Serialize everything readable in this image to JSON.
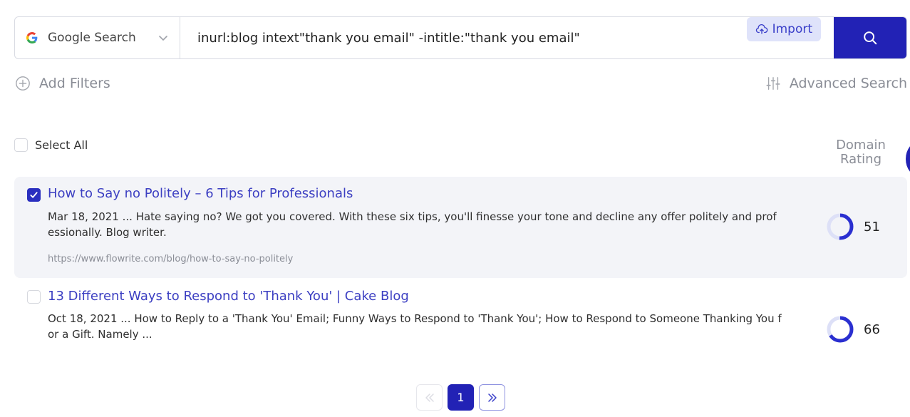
{
  "search": {
    "engine_label": "Google Search",
    "query": "inurl:blog intext\"thank you email\" -intitle:\"thank you email\"",
    "import_label": "Import"
  },
  "filters": {
    "add_label": "Add Filters",
    "advanced_label": "Advanced Search"
  },
  "list": {
    "select_all_label": "Select All",
    "dr_header_line1": "Domain",
    "dr_header_line2": "Rating"
  },
  "results": [
    {
      "title": "How to Say no Politely – 6 Tips for Professionals",
      "snippet": "Mar 18, 2021 ... Hate saying no? We got you covered. With these six tips, you'll finesse your tone and decline any offer politely and professionally. Blog writer.",
      "url": "https://www.flowrite.com/blog/how-to-say-no-politely",
      "domain_rating": 51,
      "checked": true
    },
    {
      "title": "13 Different Ways to Respond to 'Thank You' | Cake Blog",
      "snippet": "Oct 18, 2021 ... How to Reply to a 'Thank You' Email; Funny Ways to Respond to 'Thank You'; How to Respond to Someone Thanking You for a Gift. Namely ...",
      "domain_rating": 66,
      "checked": false
    }
  ],
  "pagination": {
    "current_page": "1"
  },
  "colors": {
    "primary": "#2222b5",
    "link": "#3c3fc2",
    "muted": "#8a8d96",
    "dr_track": "#dde0f7"
  }
}
